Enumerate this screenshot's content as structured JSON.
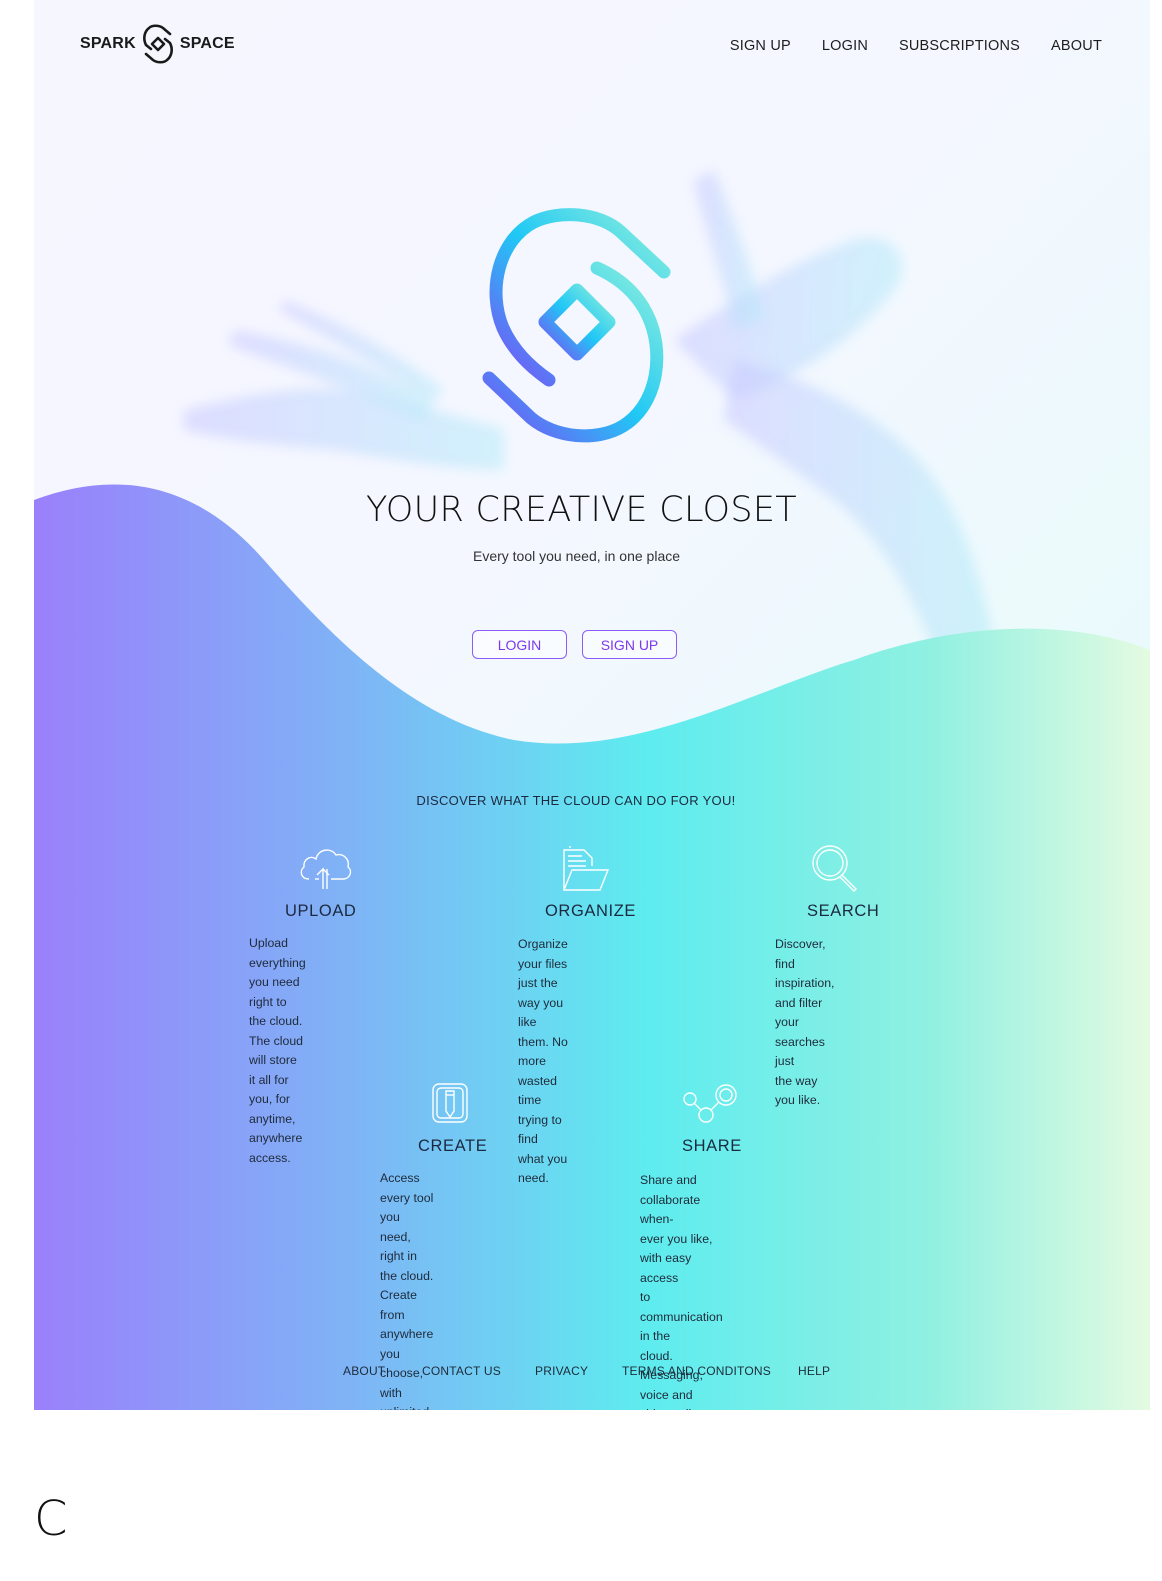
{
  "header": {
    "brand_left": "SPARK",
    "brand_right": "SPACE",
    "nav": [
      "SIGN UP",
      "LOGIN",
      "SUBSCRIPTIONS",
      "ABOUT"
    ]
  },
  "hero": {
    "title": "YOUR CREATIVE CLOSET",
    "subtitle": "Every tool you need, in one place",
    "login_label": "LOGIN",
    "signup_label": "SIGN UP"
  },
  "features": {
    "heading": "DISCOVER WHAT THE CLOUD CAN DO FOR YOU!",
    "items": [
      {
        "title": "UPLOAD",
        "icon": "cloud-upload-icon",
        "desc": "Upload everything you need\nright to the cloud. The cloud\nwill store it all for you, for\nanytime, anywhere access."
      },
      {
        "title": "ORGANIZE",
        "icon": "folder-document-icon",
        "desc": "Organize your files just the\nway you like them. No more\nwasted time trying to find\nwhat you need."
      },
      {
        "title": "SEARCH",
        "icon": "magnifier-icon",
        "desc": "Discover, find inspiration,\nand filter your searches just\nthe way you like."
      },
      {
        "title": "CREATE",
        "icon": "pencil-tablet-icon",
        "desc": "Access every tool you need,\nright in the cloud. Create\nfrom anywhere you choose,\nwith unlimited access to the\ntop tools in the market."
      },
      {
        "title": "SHARE",
        "icon": "share-nodes-icon",
        "desc": "Share and collaborate when-\never you like, with easy access\nto communication in the\ncloud. Messaging, voice and\nvideo call are one click away."
      }
    ]
  },
  "footer": {
    "links": [
      "ABOUT",
      "CONTACT US",
      "PRIVACY",
      "TERMS AND CONDITONS",
      "HELP"
    ]
  },
  "corner_label": "C",
  "colors": {
    "accent_purple": "#8b5cf6",
    "gradient_start": "#9a7dfb",
    "gradient_mid": "#5ee8ee",
    "gradient_end": "#e4fbe0"
  }
}
